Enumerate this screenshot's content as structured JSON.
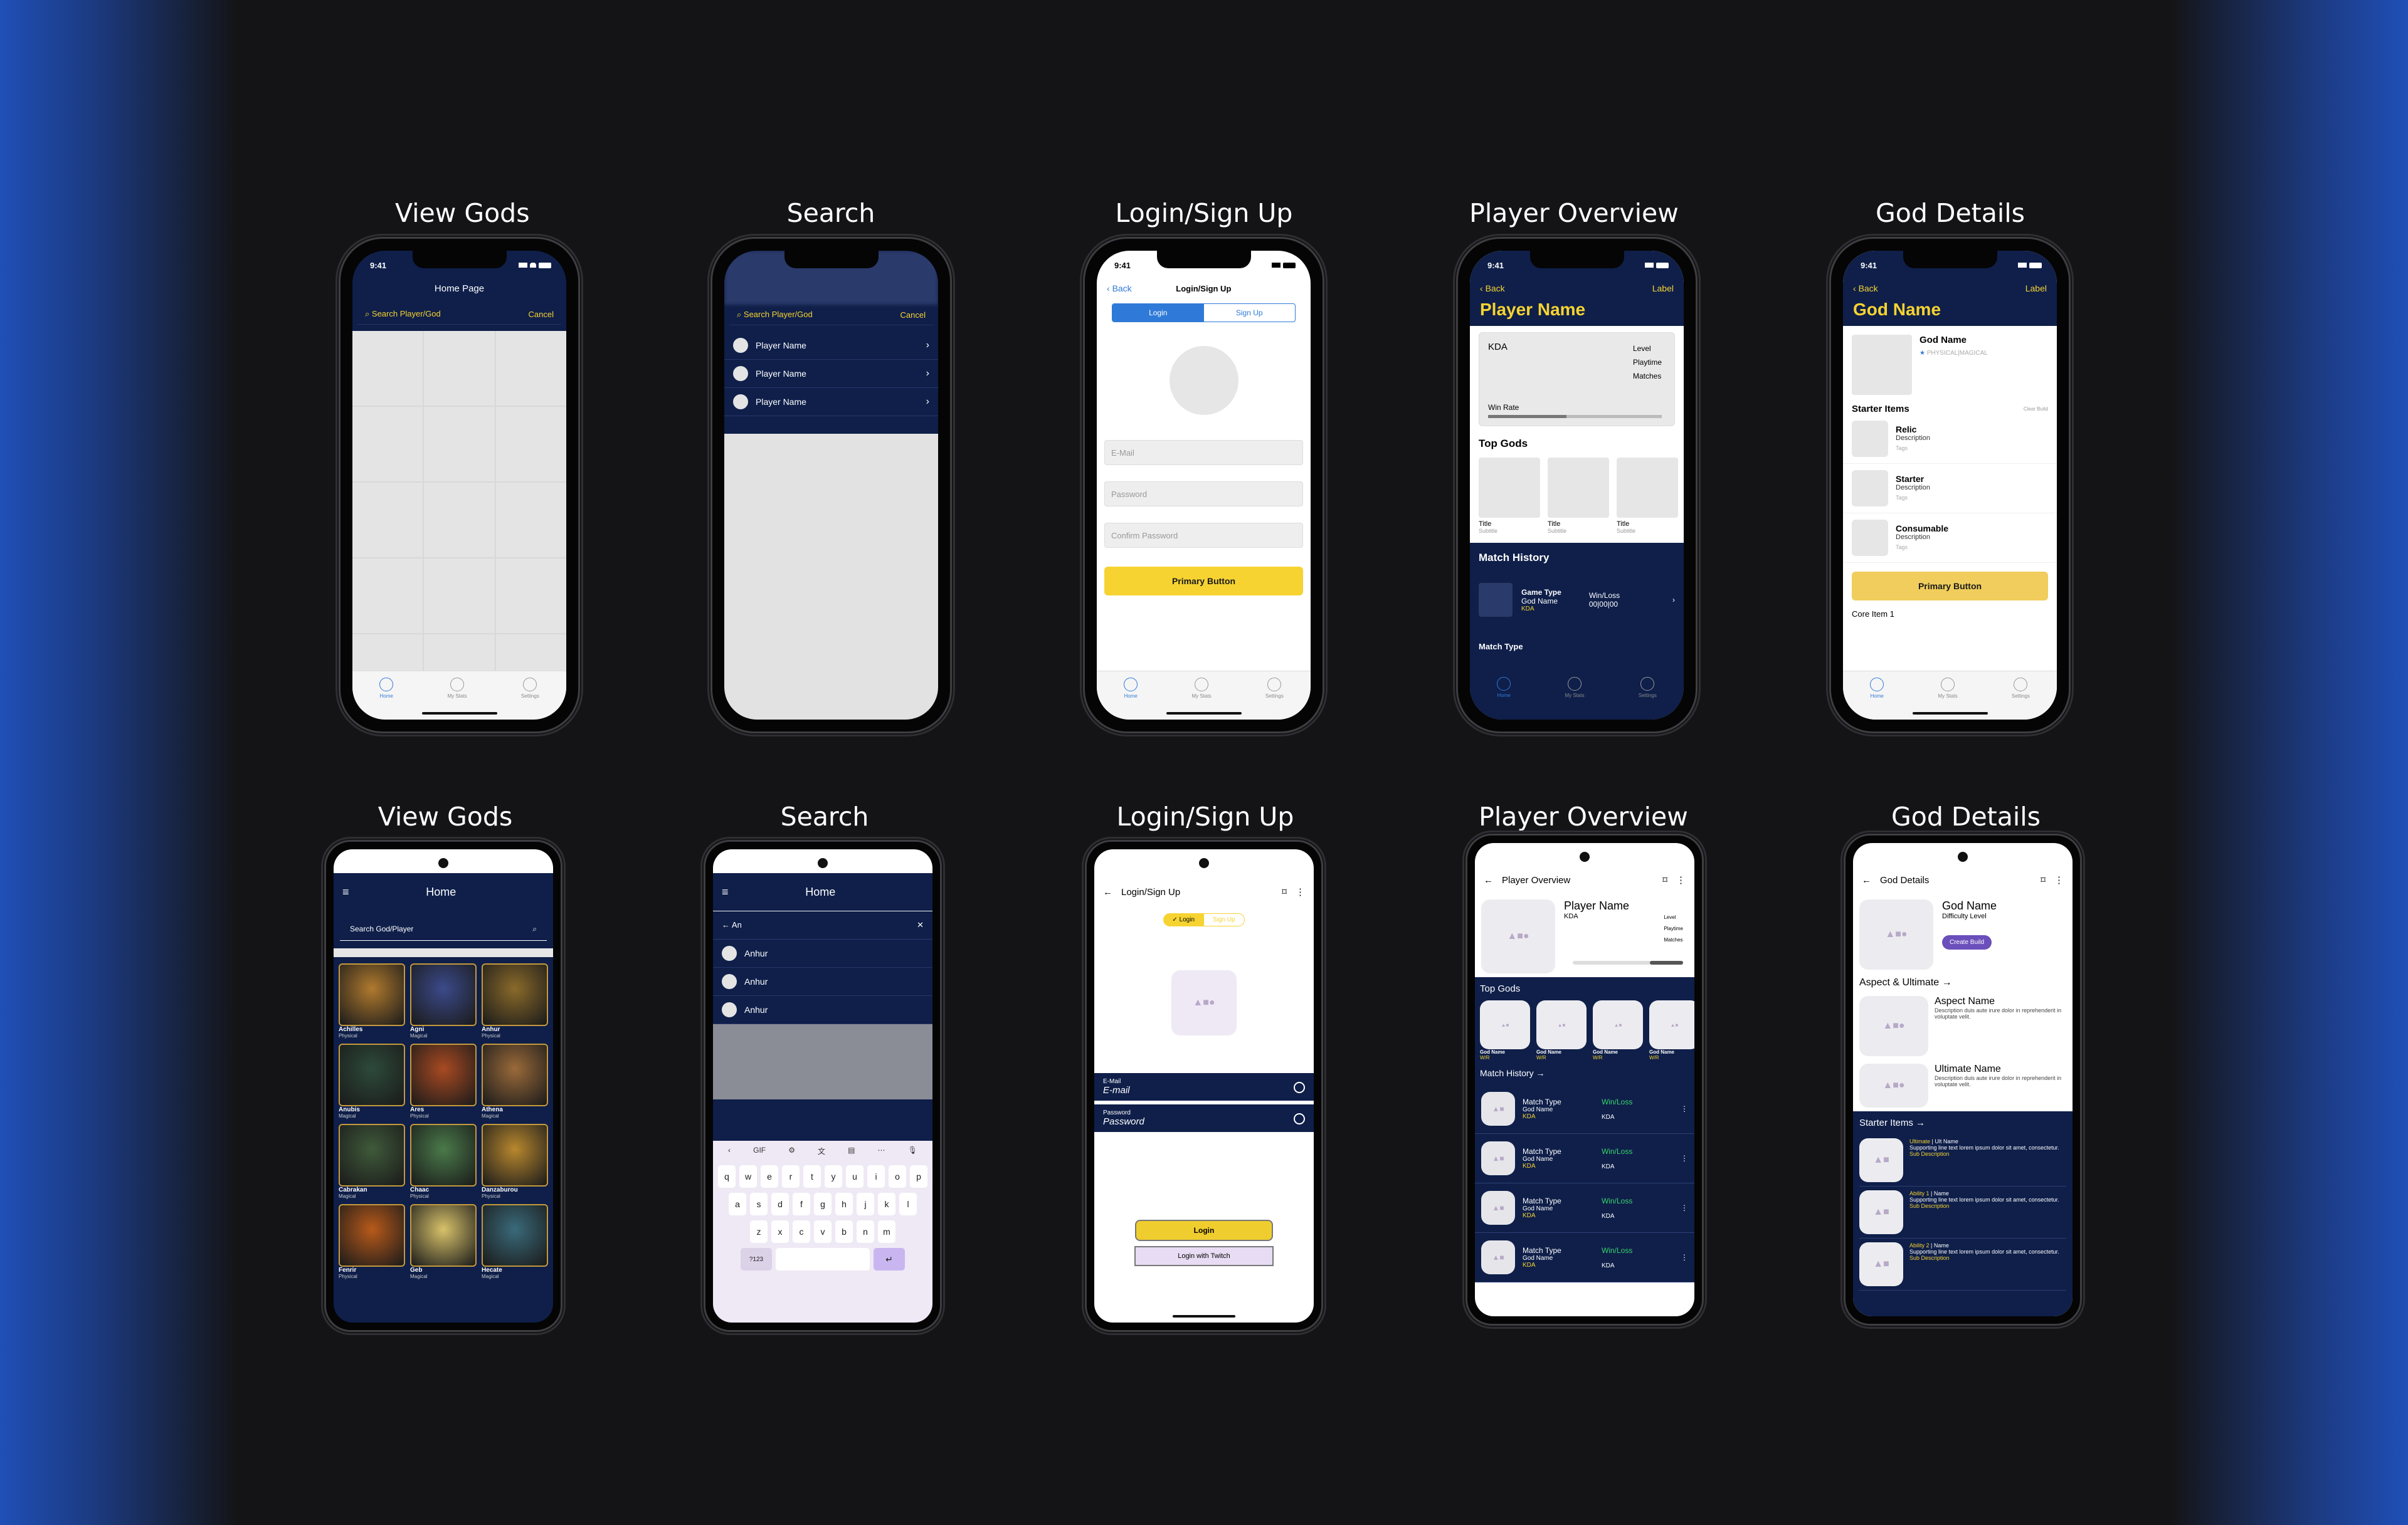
{
  "titles": {
    "row1": [
      "View Gods",
      "Search",
      "Login/Sign Up",
      "Player Overview",
      "God Details"
    ],
    "row2": [
      "View Gods",
      "Search",
      "Login/Sign Up",
      "Player Overview",
      "God Details"
    ]
  },
  "status_time": "9:41",
  "tabs": [
    "Home",
    "My Stats",
    "Settings"
  ],
  "ios_view_gods": {
    "header": "Home Page",
    "search_placeholder": "Search Player/God",
    "cancel": "Cancel"
  },
  "ios_search": {
    "search_placeholder": "Search Player/God",
    "cancel": "Cancel",
    "results": [
      "Player Name",
      "Player Name",
      "Player Name"
    ]
  },
  "ios_login": {
    "back": "Back",
    "title": "Login/Sign Up",
    "seg_login": "Login",
    "seg_signup": "Sign Up",
    "email": "E-Mail",
    "password": "Password",
    "confirm": "Confirm Password",
    "primary": "Primary Button"
  },
  "ios_player": {
    "back": "Back",
    "label": "Label",
    "name": "Player Name",
    "kda": "KDA",
    "level": "Level",
    "playtime": "Playtime",
    "matches": "Matches",
    "winrate": "Win Rate",
    "winrate_pct": 45,
    "top_gods": "Top Gods",
    "god_title": "Title",
    "god_sub": "Subtitle",
    "history": "Match History",
    "game_type": "Game Type",
    "god_name": "God Name",
    "kda_small": "KDA",
    "winloss": "Win/Loss",
    "score": "00|00|00",
    "match_type": "Match Type"
  },
  "ios_god": {
    "back": "Back",
    "label": "Label",
    "title": "God Name",
    "god_name": "God Name",
    "type": "PHYSICAL|MAGICAL",
    "starter": "Starter Items",
    "clear": "Clear Build",
    "items": [
      {
        "name": "Relic",
        "desc": "Description",
        "tags": "Tags"
      },
      {
        "name": "Starter",
        "desc": "Description",
        "tags": "Tags"
      },
      {
        "name": "Consumable",
        "desc": "Description",
        "tags": "Tags"
      }
    ],
    "primary": "Primary Button",
    "core": "Core Item 1"
  },
  "and_view_gods": {
    "header": "Home",
    "search": "Search God/Player",
    "heroes": [
      {
        "n": "Achilles",
        "t": "Physical",
        "c": "#b07a2e"
      },
      {
        "n": "Agni",
        "t": "Magical",
        "c": "#3b4a8a"
      },
      {
        "n": "Anhur",
        "t": "Physical",
        "c": "#8a6a2a"
      },
      {
        "n": "Anubis",
        "t": "Magical",
        "c": "#2d4a3a"
      },
      {
        "n": "Ares",
        "t": "Physical",
        "c": "#a84a22"
      },
      {
        "n": "Athena",
        "t": "Magical",
        "c": "#9a6a3a"
      },
      {
        "n": "Cabrakan",
        "t": "Magical",
        "c": "#3f5a3a"
      },
      {
        "n": "Chaac",
        "t": "Physical",
        "c": "#4a7a4a"
      },
      {
        "n": "Danzaburou",
        "t": "Physical",
        "c": "#b8882e"
      },
      {
        "n": "Fenrir",
        "t": "Physical",
        "c": "#b85a1a"
      },
      {
        "n": "Geb",
        "t": "Magical",
        "c": "#d8c26a"
      },
      {
        "n": "Hecate",
        "t": "Magical",
        "c": "#3a6a7a"
      }
    ]
  },
  "and_search": {
    "header": "Home",
    "query": "An",
    "results": [
      "Anhur",
      "Anhur",
      "Anhur"
    ],
    "kb_rows": [
      "qwertyuiop",
      "asdfghjkl",
      "zxcvbnm"
    ],
    "num": "?123",
    "gif": "GIF"
  },
  "and_login": {
    "title": "Login/Sign Up",
    "login": "Login",
    "signup": "Sign Up",
    "email_label": "E-Mail",
    "email": "E-mail",
    "pw_label": "Password",
    "pw": "Password",
    "btn": "Login",
    "twitch": "Login with Twitch"
  },
  "and_player": {
    "title": "Player Overview",
    "name": "Player Name",
    "kda": "KDA",
    "level": "Level",
    "playtime": "Playtime",
    "matches": "Matches",
    "top": "Top Gods",
    "god": "God Name",
    "wr": "W/R",
    "history": "Match History",
    "match": "Match Type",
    "winloss": "Win/Loss",
    "kda_s": "KDA"
  },
  "and_god": {
    "title": "God Details",
    "name": "God Name",
    "difficulty": "Difficulty Level",
    "create": "Create Build",
    "aspect_title": "Aspect & Ultimate",
    "aspect": "Aspect Name",
    "ult": "Ultimate Name",
    "lorem": "Description duis aute irure dolor in reprehenderit in voluptate velit.",
    "starter": "Starter Items",
    "abilities": [
      {
        "k": "Ultimate",
        "n": "Ult Name"
      },
      {
        "k": "Ability 1",
        "n": "Name"
      },
      {
        "k": "Ability 2",
        "n": "Name"
      }
    ],
    "support": "Supporting line text lorem ipsum dolor sit amet, consectetur.",
    "subdesc": "Sub Description"
  }
}
